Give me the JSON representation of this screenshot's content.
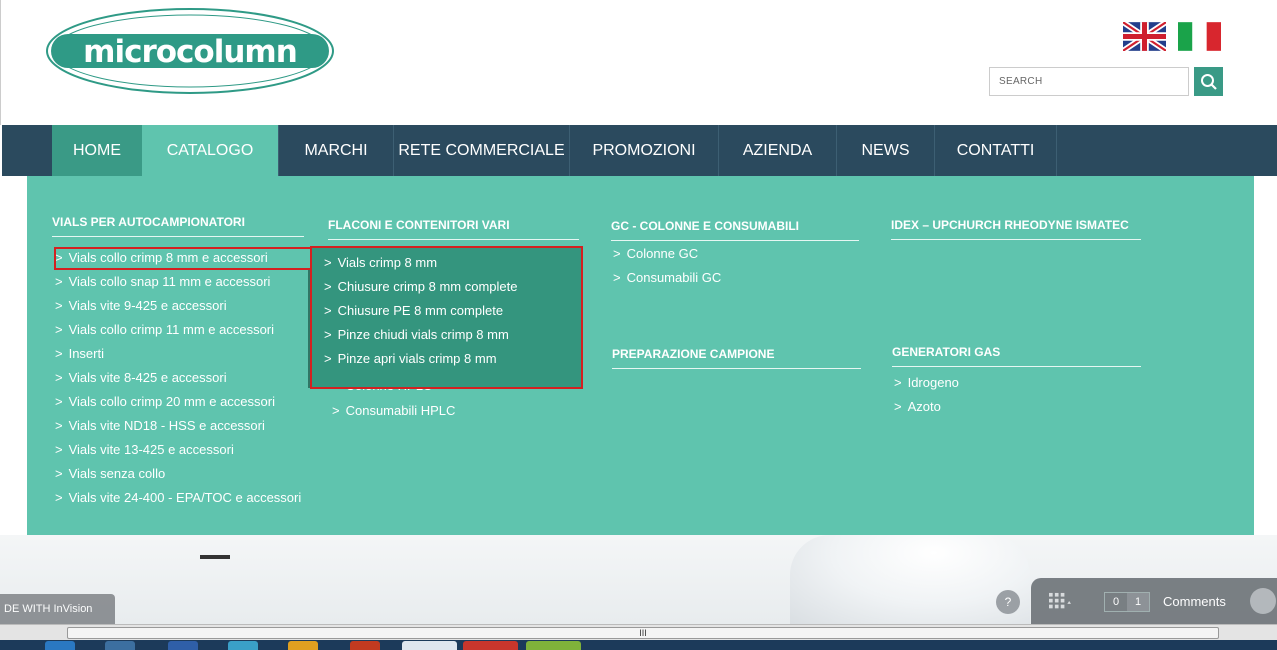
{
  "header": {
    "logo_text": "MICROCOLUMN",
    "search": {
      "placeholder": "SEARCH"
    },
    "flags": [
      "english-flag",
      "italian-flag"
    ]
  },
  "nav": {
    "items": [
      {
        "label": "HOME"
      },
      {
        "label": "CATALOGO"
      },
      {
        "label": "MARCHI"
      },
      {
        "label": "RETE COMMERCIALE"
      },
      {
        "label": "PROMOZIONI"
      },
      {
        "label": "AZIENDA"
      },
      {
        "label": "NEWS"
      },
      {
        "label": "CONTATTI"
      }
    ]
  },
  "mega": {
    "col1": {
      "title": "VIALS PER AUTOCAMPIONATORI",
      "links": [
        "Vials collo crimp 8 mm e accessori",
        "Vials collo snap 11 mm e accessori",
        "Vials vite 9-425 e accessori",
        "Vials collo crimp 11 mm e accessori",
        "Inserti",
        "Vials vite 8-425 e accessori",
        "Vials collo crimp 20 mm e accessori",
        "Vials vite ND18 - HSS e accessori",
        "Vials vite 13-425 e accessori",
        "Vials senza collo",
        "Vials vite 24-400 - EPA/TOC e accessori"
      ]
    },
    "col2": {
      "title": "FLACONI E CONTENITORI VARI",
      "hidden_links": [
        "Colonne HPLC",
        "Consumabili HPLC"
      ]
    },
    "col3": {
      "title": "GC - COLONNE E CONSUMABILI",
      "links": [
        "Colonne GC",
        "Consumabili GC"
      ],
      "title2": "PREPARAZIONE CAMPIONE"
    },
    "col4": {
      "title": "IDEX – UPCHURCH RHEODYNE ISMATEC",
      "title2": "GENERATORI GAS",
      "links": [
        "Idrogeno",
        "Azoto"
      ]
    },
    "submenu": {
      "links": [
        "Vials crimp  8 mm",
        "Chiusure crimp  8 mm complete",
        "Chiusure PE  8 mm complete",
        "Pinze chiudi vials crimp  8 mm",
        "Pinze apri vials crimp  8 mm"
      ]
    },
    "arrow": ">"
  },
  "overlay": {
    "badge": "DE WITH InVision",
    "help": "?",
    "comments_count_a": "0",
    "comments_count_b": "1",
    "comments_label": "Comments"
  },
  "scrollbar": {
    "grip": "III"
  },
  "colors": {
    "nav_bg": "#2b4a5e",
    "accent_dark": "#3a9a86",
    "accent_light": "#5fc4ae",
    "submenu_bg": "#34957e",
    "highlight": "#d42020"
  }
}
